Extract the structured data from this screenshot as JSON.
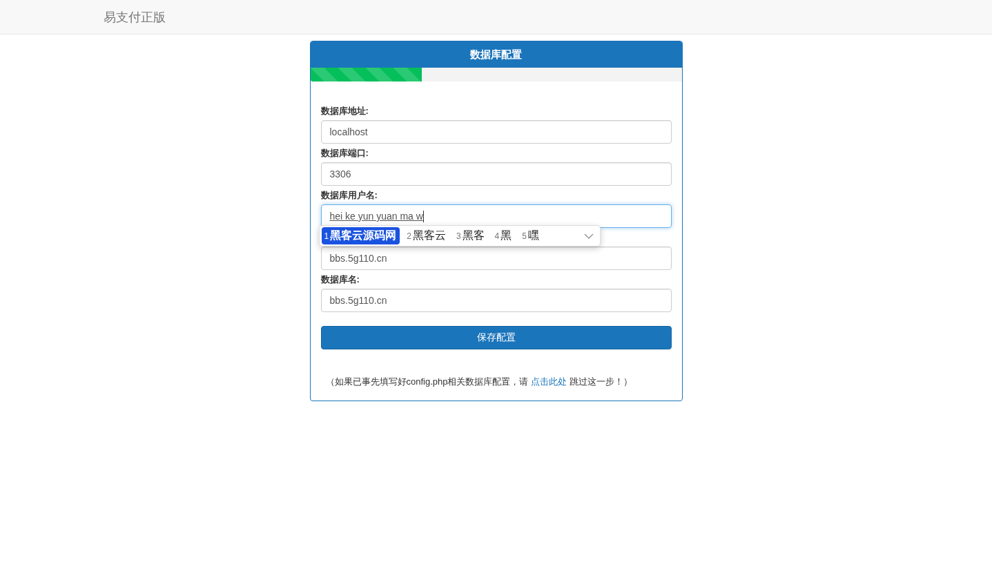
{
  "navbar": {
    "brand": "易支付正版"
  },
  "panel": {
    "title": "数据库配置",
    "progress": {
      "level": 0.3
    },
    "fields": [
      {
        "label": "数据库地址:",
        "value": "localhost",
        "focused": false,
        "composing": false
      },
      {
        "label": "数据库端口:",
        "value": "3306",
        "focused": false,
        "composing": false
      },
      {
        "label": "数据库用户名:",
        "value": "hei ke yun yuan ma w",
        "focused": true,
        "composing": true
      },
      {
        "value": "bbs.5g110.cn",
        "focused": false,
        "composing": false
      },
      {
        "label": "数据库名:",
        "value": "bbs.5g110.cn",
        "focused": false,
        "composing": false
      }
    ],
    "submit": "保存配置",
    "note": {
      "before": "（如果已事先填写好config.php相关数据库配置，请",
      "link": "点击此处",
      "after": "跳过这一步！）"
    }
  },
  "ime": {
    "candidates": [
      {
        "index": "1",
        "text": "黑客云源码网",
        "selected": true
      },
      {
        "index": "2",
        "text": "黑客云",
        "selected": false
      },
      {
        "index": "3",
        "text": "黑客",
        "selected": false
      },
      {
        "index": "4",
        "text": "黑",
        "selected": false
      },
      {
        "index": "5",
        "text": "嘿",
        "selected": false
      }
    ]
  }
}
